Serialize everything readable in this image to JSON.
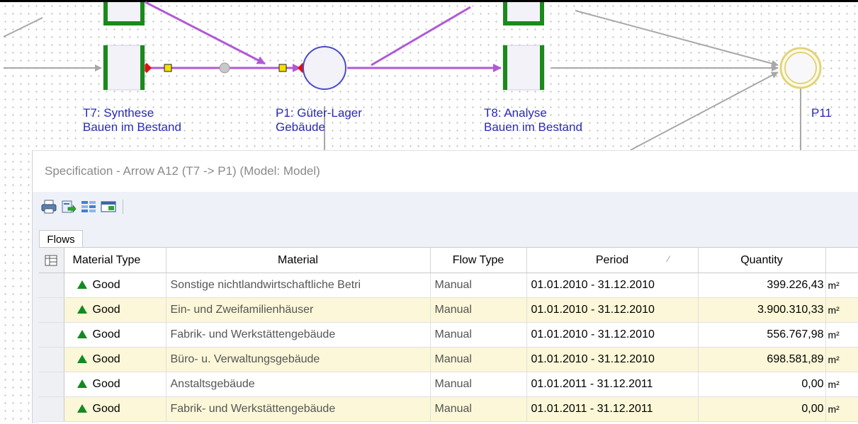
{
  "diagram": {
    "nodes": [
      {
        "id": "T7",
        "label_line1": "T7: Synthese",
        "label_line2": "Bauen im Bestand"
      },
      {
        "id": "P1",
        "label_line1": "P1: Güter-Lager",
        "label_line2": "Gebäude"
      },
      {
        "id": "T8",
        "label_line1": "T8: Analyse",
        "label_line2": "Bauen im Bestand"
      },
      {
        "id": "P11",
        "label_line1": "P11"
      }
    ],
    "colors": {
      "transition_border": "#1a8a1a",
      "transition_fill": "#f2f2f8",
      "place_border": "#4b4bc8",
      "place_target_border": "#e2d37a",
      "selected_arrow": "#b05ad6",
      "gray_arrow": "#a8a8a8",
      "label_text": "#2a2ab8"
    }
  },
  "spec": {
    "title": "Specification - Arrow A12 (T7 -> P1) (Model: Model)",
    "toolbar": [
      {
        "name": "print-icon"
      },
      {
        "name": "export-icon"
      },
      {
        "name": "columns-icon"
      },
      {
        "name": "window-icon"
      }
    ],
    "tabs": [
      {
        "label": "Flows"
      }
    ],
    "columns": {
      "material_type": "Material Type",
      "material": "Material",
      "flow_type": "Flow Type",
      "period": "Period",
      "quantity": "Quantity"
    },
    "rows": [
      {
        "material_type": "Good",
        "material": "Sonstige nichtlandwirtschaftliche Betri",
        "flow_type": "Manual",
        "period": "01.01.2010 - 31.12.2010",
        "quantity": "399.226,43",
        "unit": "m²"
      },
      {
        "material_type": "Good",
        "material": "Ein- und Zweifamilienhäuser",
        "flow_type": "Manual",
        "period": "01.01.2010 - 31.12.2010",
        "quantity": "3.900.310,33",
        "unit": "m²"
      },
      {
        "material_type": "Good",
        "material": "Fabrik- und Werkstättengebäude",
        "flow_type": "Manual",
        "period": "01.01.2010 - 31.12.2010",
        "quantity": "556.767,98",
        "unit": "m²"
      },
      {
        "material_type": "Good",
        "material": "Büro- u. Verwaltungsgebäude",
        "flow_type": "Manual",
        "period": "01.01.2010 - 31.12.2010",
        "quantity": "698.581,89",
        "unit": "m²"
      },
      {
        "material_type": "Good",
        "material": "Anstaltsgebäude",
        "flow_type": "Manual",
        "period": "01.01.2011 - 31.12.2011",
        "quantity": "0,00",
        "unit": "m²"
      },
      {
        "material_type": "Good",
        "material": "Fabrik- und Werkstättengebäude",
        "flow_type": "Manual",
        "period": "01.01.2011 - 31.12.2011",
        "quantity": "0,00",
        "unit": "m²"
      }
    ],
    "row_colors": {
      "even": "#ffffff",
      "odd": "#fbf7d8"
    },
    "good_icon_color": "#138a22"
  }
}
